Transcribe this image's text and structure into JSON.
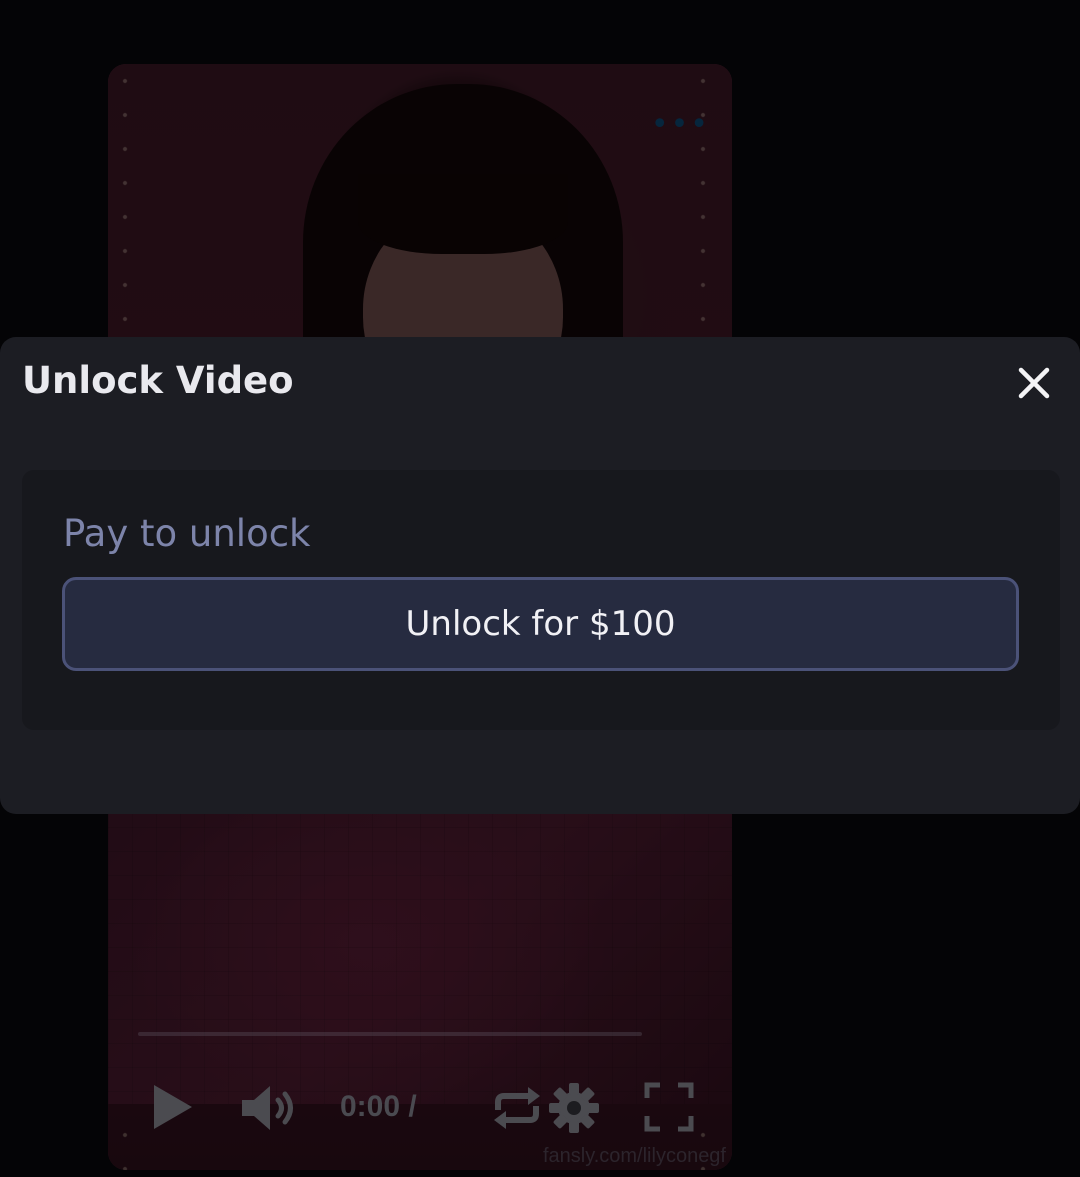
{
  "player": {
    "more_icon": "more-dots-icon",
    "time": "0:00 /",
    "watermark": "fansly.com/lilyconegf",
    "icons": [
      "play-icon",
      "volume-icon",
      "loop-icon",
      "gear-icon",
      "fullscreen-icon"
    ]
  },
  "modal": {
    "title": "Unlock Video",
    "close_icon": "close-icon",
    "section_label": "Pay to unlock",
    "unlock_button_label": "Unlock for $100"
  },
  "colors": {
    "modal_background": "#1c1d23",
    "card_background": "#17181d",
    "button_background": "#262b40",
    "button_border": "#4b5278",
    "label_color": "#7d84aa",
    "title_color": "#e9e9ee"
  }
}
